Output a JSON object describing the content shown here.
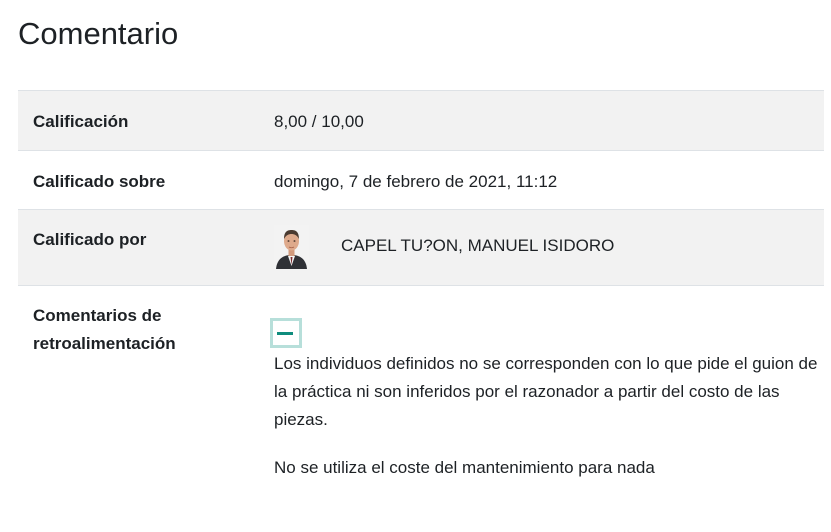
{
  "page": {
    "title": "Comentario"
  },
  "grade": {
    "label": "Calificación",
    "value": "8,00 / 10,00"
  },
  "graded_on": {
    "label": "Calificado sobre",
    "value": "domingo, 7 de febrero de 2021, 11:12"
  },
  "graded_by": {
    "label": "Calificado por",
    "name": "CAPEL TU?ON, MANUEL ISIDORO",
    "avatar_icon": "user-photo"
  },
  "feedback": {
    "label": "Comentarios de retroalimentación",
    "collapse_icon": "minus-icon",
    "paragraphs": [
      "Los individuos definidos no se corresponden con lo que pide el guion de la práctica ni son inferidos por el razonador a partir del costo de las piezas.",
      "No se utiliza el coste del mantenimiento para nada"
    ]
  },
  "colors": {
    "row_shade": "#f2f2f2",
    "accent": "#0f8c7d",
    "accent_border": "#b7dfda",
    "text": "#1d2125"
  }
}
